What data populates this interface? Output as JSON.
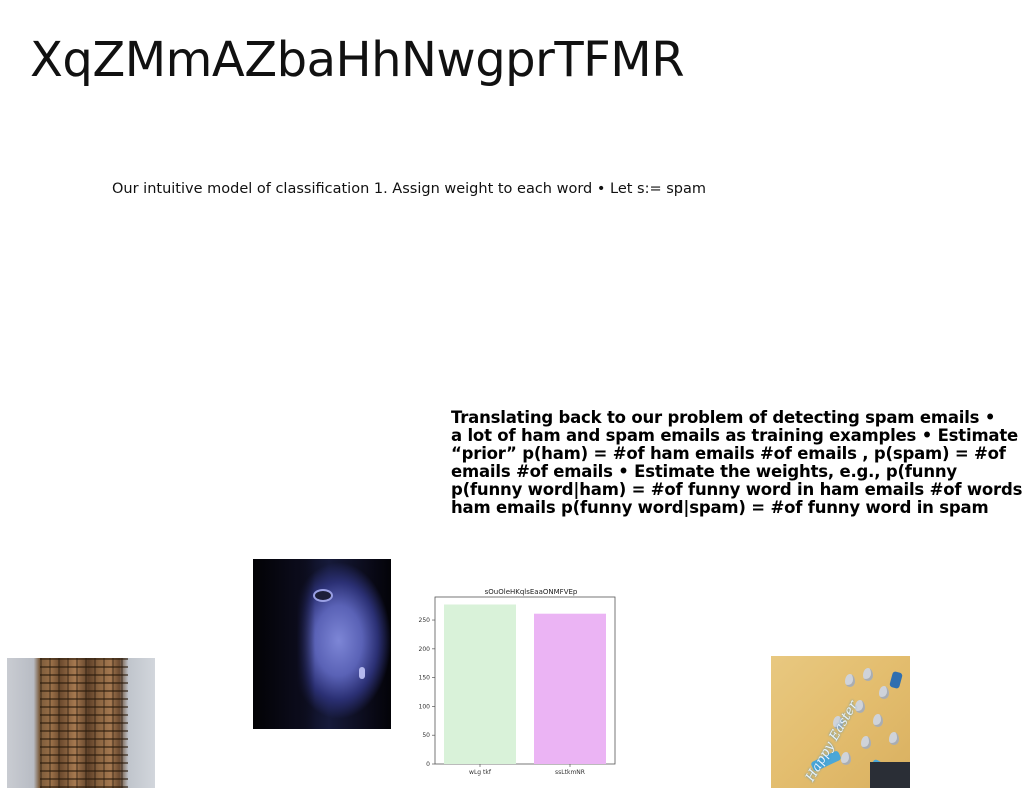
{
  "slide": {
    "title": "XqZMmAZbaHhNwgprTFMR",
    "subtitle": "Our intuitive model of classification 1. Assign weight to each word • Let s:= spam",
    "body_lines": [
      "Translating back to our problem of detecting spam emails •",
      "a lot of ham and spam emails as training examples • Estimate",
      "“prior” p(ham) = #of ham emails #of emails , p(spam) = #of",
      "emails #of emails • Estimate the weights, e.g., p(funny",
      "p(funny word|ham) = #of funny word in ham emails #of words",
      "ham emails p(funny word|spam) = #of funny word in spam"
    ]
  },
  "images": {
    "building": "photo-building-facade",
    "face": "photo-woman-face-blue",
    "easter": "photo-happy-easter-eggs",
    "easter_text": "Happy Easter"
  },
  "chart_data": {
    "type": "bar",
    "title": "sOuOleHKqlsEaaONMFVEp",
    "categories": [
      "wLg tkf",
      "ssLtkmNR"
    ],
    "values": [
      277,
      261
    ],
    "colors": [
      "#d9f2d9",
      "#ebb4f4"
    ],
    "xlabel": "",
    "ylabel": "",
    "ylim": [
      0,
      290
    ],
    "yticks": [
      0,
      50,
      100,
      150,
      200,
      250
    ],
    "grid": false
  }
}
